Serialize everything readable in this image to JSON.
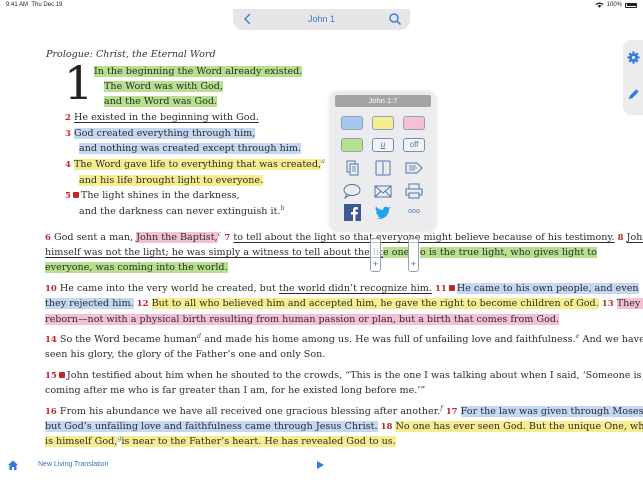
{
  "status": {
    "time": "9:41 AM",
    "date": "Thu Dec 19",
    "battery": "100%"
  },
  "nav": {
    "title": "John 1"
  },
  "heading": "Prologue: Christ, the Eternal Word",
  "dropcap": "1",
  "verses": {
    "v1a": "In the beginning the Word already existed.",
    "v1b": "The Word was with God,",
    "v1c": "and the Word was God.",
    "n2": "2",
    "v2": "He existed in the beginning with God.",
    "n3": "3",
    "v3a": "God created everything through him,",
    "v3b": "and nothing was created except through him.",
    "n4": "4",
    "v4a": "The Word gave life to everything that was created,",
    "fa": "a",
    "v4b": "and his life brought light to everyone.",
    "n5": "5",
    "v5a": "The light shines in the darkness,",
    "v5b": "and the darkness can never extinguish it.",
    "fb": "b",
    "n6": "6",
    "v6a": "God sent a man,",
    "v6b": "John the Baptist,",
    "fc": "c",
    "n7": "7",
    "v7a": "to tell about the light so that everyone might believe because of his testimony.",
    "n8": "8",
    "v8a": "John",
    "v8b": "himself was not the light; he was simply a witness to tell about the light.",
    "n9": "9",
    "v9a": "e one",
    "v9b": "o is the true light, who gives light to",
    "v9c": "everyone, was coming into the world.",
    "n10": "10",
    "v10a": "He came into the very world he created, but",
    "v10b": "the world didn’t recognize him.",
    "n11": "11",
    "v11a": "He came to his own people, and even",
    "v11b": "they rejected him.",
    "n12": "12",
    "v12": "But to all who believed him and accepted him, he gave the right to become children of God.",
    "n13": "13",
    "v13a": "They are",
    "v13b": "reborn—not with a physical birth resulting from human passion or plan, but a birth that comes from God.",
    "n14": "14",
    "v14a": "So the Word became human",
    "fd": "d",
    "v14b": "and made his home among us. He was full of unfailing love and faithfulness.",
    "fe": "e",
    "v14c": "And we have",
    "v14d": "seen his glory, the glory of the Father’s one and only Son.",
    "n15": "15",
    "v15a": "John testified about him when he shouted to the crowds, “This is the one I was talking about when I said, ‘Someone is",
    "v15b": "coming after me who is far greater than I am, for he existed long before me.’”",
    "n16": "16",
    "v16a": "From his abundance we have all received one gracious blessing after another.",
    "ff": "f",
    "n17": "17",
    "v17a": "For the law was given through Moses,",
    "v17b": "but God’s unfailing love and faithfulness came through Jesus Christ.",
    "n18": "18",
    "v18a": "No one has ever seen God. But the unique One, who",
    "v18b": "is himself God,",
    "fg": "g",
    "v18c": "is near to the Father’s heart. He has revealed God to us."
  },
  "popup": {
    "title": "John 1:7",
    "underline_label": "u",
    "off_label": "off",
    "more_label": "ooo",
    "swatches": [
      "#a9c7ec",
      "#f6ee8e",
      "#f4c0d6",
      "#b6e08d"
    ]
  },
  "handles": {
    "left": "+",
    "right": "+"
  },
  "bottom": {
    "translation": "New Living Translation"
  },
  "colors": {
    "accent": "#3a7bd5",
    "verse_number": "#c0282b"
  }
}
